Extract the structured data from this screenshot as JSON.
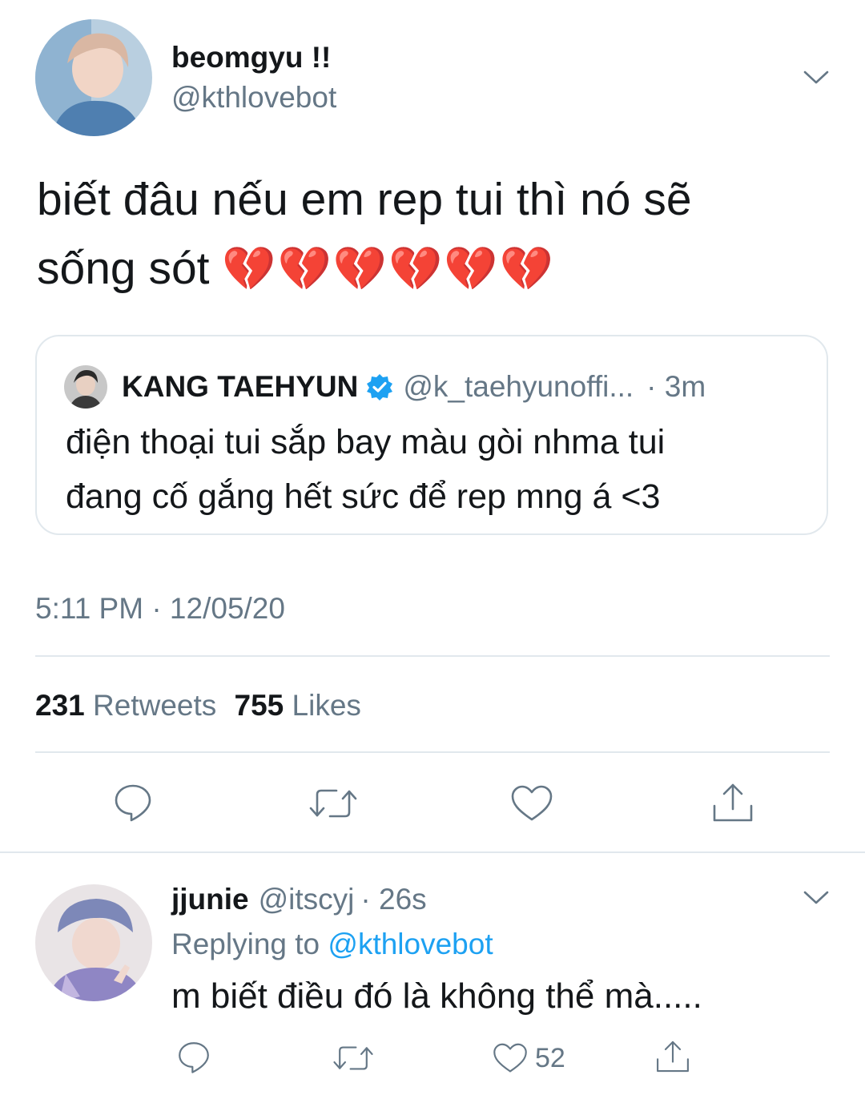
{
  "tweet": {
    "display_name": "beomgyu !!",
    "handle": "@kthlovebot",
    "text_line1": "biết đâu nếu em rep tui thì nó sẽ",
    "text_line2": "sống sót",
    "emoji": "💔💔💔💔💔💔",
    "timestamp": "5:11 PM · 12/05/20",
    "retweets_count": "231",
    "retweets_label": "Retweets",
    "likes_count": "755",
    "likes_label": "Likes"
  },
  "quoted": {
    "display_name": "KANG TAEHYUN",
    "handle": "@k_taehyunoffi...",
    "time": "· 3m",
    "text_line1": "điện thoại tui sắp bay màu gòi nhma tui",
    "text_line2": "đang cố gắng hết sức để rep mng á <3"
  },
  "reply": {
    "display_name": "jjunie",
    "handle": "@itscyj",
    "time": "· 26s",
    "replying_label": "Replying to",
    "replying_handle": "@kthlovebot",
    "text": "m biết điều đó là không thể mà.....",
    "likes_count": "52"
  },
  "icons": {
    "menu": "chevron-down-icon",
    "reply": "comment-icon",
    "retweet": "retweet-icon",
    "like": "heart-icon",
    "share": "share-icon",
    "verified": "verified-badge-icon"
  },
  "colors": {
    "accent": "#1da1f2",
    "secondary_text": "#657786",
    "divider": "#e1e8ed",
    "heart_emoji": "#ff2d8f"
  }
}
